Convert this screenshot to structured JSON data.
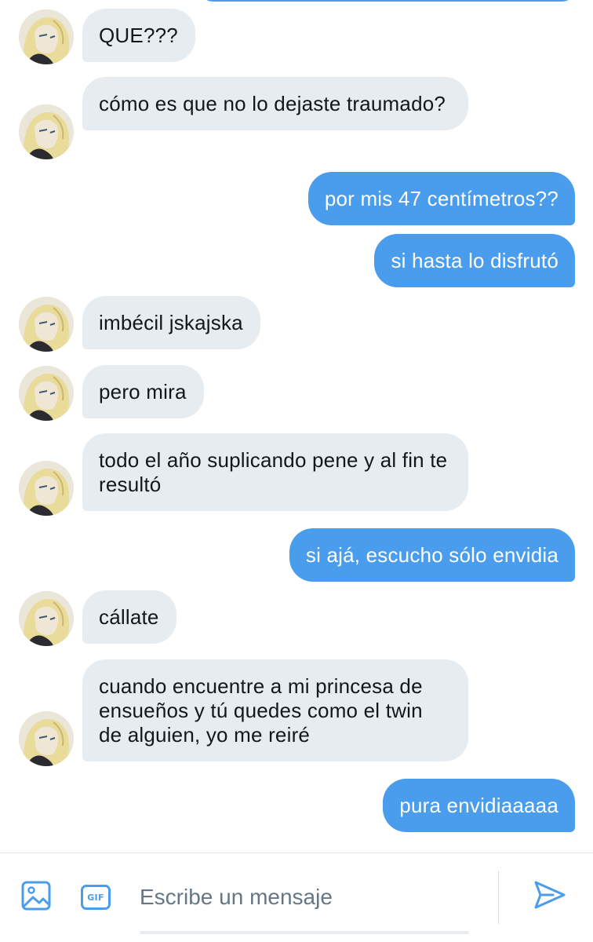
{
  "conversation": {
    "messages": [
      {
        "side": "in",
        "text": "QUE???"
      },
      {
        "side": "in",
        "text": "cómo es que no lo dejaste traumado?"
      },
      {
        "side": "out",
        "text": "por mis 47 centímetros??"
      },
      {
        "side": "out",
        "text": "si hasta lo disfrutó"
      },
      {
        "side": "in",
        "text": "imbécil jskajska"
      },
      {
        "side": "in",
        "text": "pero mira"
      },
      {
        "side": "in",
        "text": "todo el año suplicando pene y al fin te resultó"
      },
      {
        "side": "out",
        "text": "si ajá, escucho sólo envidia"
      },
      {
        "side": "in",
        "text": "cállate"
      },
      {
        "side": "in",
        "text": "cuando encuentre a mi princesa de ensueños y tú quedes como el twin de alguien, yo me reiré"
      },
      {
        "side": "out",
        "text": "pura envidiaaaaa"
      }
    ]
  },
  "composer": {
    "placeholder": "Escribe un mensaje",
    "value": "",
    "gif_label": "GIF",
    "icons": {
      "media": "image-icon",
      "gif": "gif-icon",
      "send": "send-icon"
    }
  },
  "colors": {
    "outgoing_bubble": "#4a9cec",
    "incoming_bubble": "#e6ecf0",
    "accent": "#4a9cec"
  }
}
